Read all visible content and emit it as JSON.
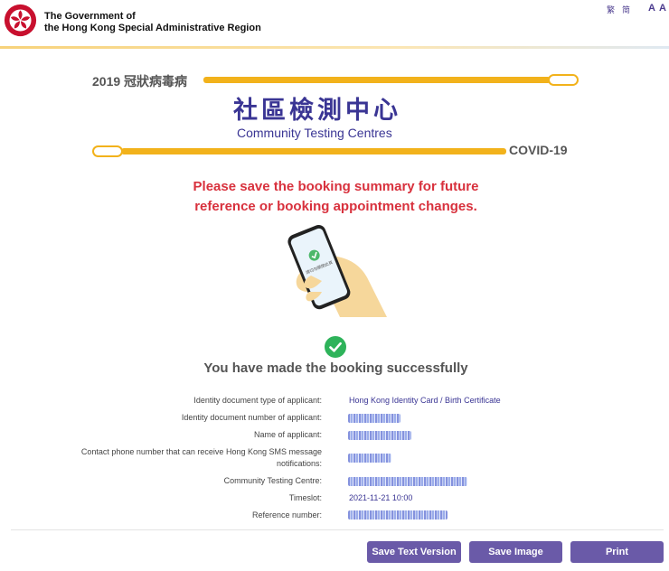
{
  "header": {
    "gov_title_line1": "The Government of",
    "gov_title_line2": "the Hong Kong Special Administrative Region",
    "lang_traditional": "繁",
    "lang_simplified": "简",
    "font_small": "A",
    "font_large": "A"
  },
  "banner": {
    "top_text": "2019 冠狀病毒病",
    "title_cn": "社區檢測中心",
    "title_en": "Community Testing Centres",
    "bottom_text": "COVID-19"
  },
  "warning": {
    "line1": "Please save the booking summary for future",
    "line2": "reference or booking appointment changes."
  },
  "illustration": {
    "phone_text": "請切勿關閉此頁"
  },
  "success": {
    "icon": "check-circle-icon",
    "message": "You have made the booking successfully"
  },
  "summary": {
    "id_type_label": "Identity document type of applicant:",
    "id_type_value": "Hong Kong Identity Card / Birth Certificate",
    "id_number_label": "Identity document number of applicant:",
    "name_label": "Name of applicant:",
    "phone_label_line1": "Contact phone number that can receive Hong Kong SMS message",
    "phone_label_line2": "notifications:",
    "centre_label": "Community Testing Centre:",
    "timeslot_label": "Timeslot:",
    "timeslot_value": "2021-11-21 10:00",
    "reference_label": "Reference number:"
  },
  "buttons": {
    "save_text": "Save Text Version",
    "save_image": "Save Image",
    "print": "Print"
  },
  "colors": {
    "accent_purple": "#3a3594",
    "button_purple": "#6a5aa8",
    "warning_red": "#d8313d",
    "swab_yellow": "#f2b21b",
    "success_green": "#2eb35a"
  }
}
